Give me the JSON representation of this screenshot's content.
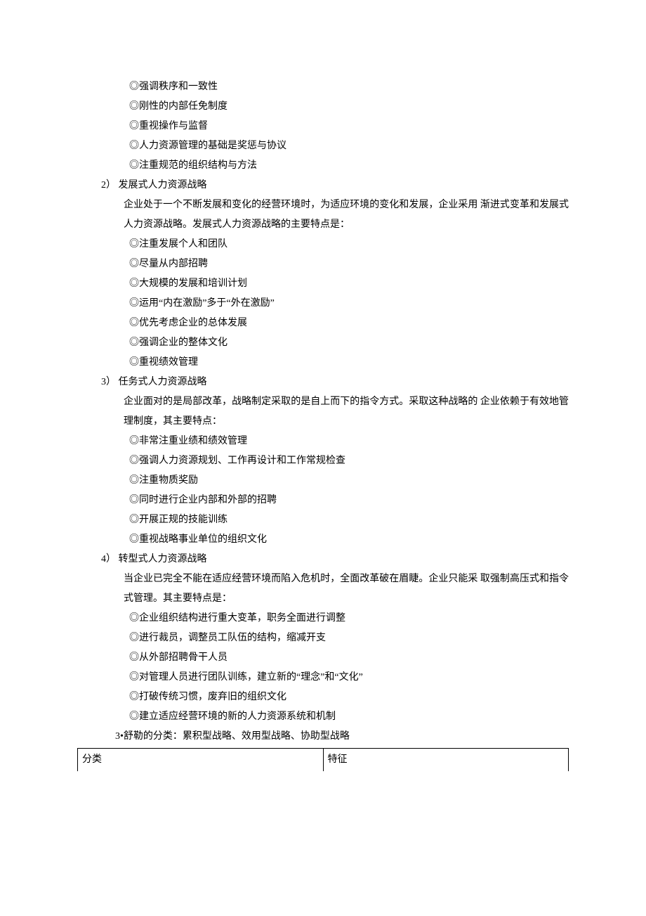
{
  "sec1": {
    "bullets": [
      "◎强调秩序和一致性",
      "◎刚性的内部任免制度",
      "◎重视操作与监督",
      "◎人力资源管理的基础是奖惩与协议",
      "◎注重规范的组织结构与方法"
    ]
  },
  "sec2": {
    "title": "2） 发展式人力资源战略",
    "intro": "企业处于一个不断发展和变化的经营环境时，为适应环境的变化和发展，企业采用 渐进式变革和发展式人力资源战略。发展式人力资源战略的主要特点是：",
    "bullets": [
      "◎注重发展个人和团队",
      "◎尽量从内部招聘",
      "◎大规模的发展和培训计划",
      "◎运用“内在激励”多于“外在激励”",
      "◎优先考虑企业的总体发展",
      "◎强调企业的整体文化",
      "◎重视绩效管理"
    ]
  },
  "sec3": {
    "title": "3） 任务式人力资源战略",
    "intro": "企业面对的是局部改革，战略制定采取的是自上而下的指令方式。采取这种战略的 企业依赖于有效地管理制度，其主要特点：",
    "bullets": [
      "◎非常注重业绩和绩效管理",
      "◎强调人力资源规划、工作再设计和工作常规检查",
      "◎注重物质奖励",
      "◎同时进行企业内部和外部的招聘",
      "◎开展正规的技能训练",
      "◎重视战略事业单位的组织文化"
    ]
  },
  "sec4": {
    "title": "4） 转型式人力资源战略",
    "intro": "当企业已完全不能在适应经营环境而陷入危机时，全面改革破在眉睫。企业只能采 取强制高压式和指令式管理。其主要特点是：",
    "bullets": [
      "◎企业组织结构进行重大变革，职务全面进行调整",
      "◎进行裁员，调整员工队伍的结构，缩减开支",
      "◎从外部招聘骨干人员",
      "◎对管理人员进行团队训练，建立新的“理念”和“文化”",
      "◎打破传统习惯，废弃旧的组织文化",
      "◎建立适应经营环境的新的人力资源系统和机制"
    ]
  },
  "summary": "3•舒勒的分类：累积型战略、效用型战略、协助型战略",
  "table": {
    "h1": "分类",
    "h2": "特征"
  }
}
